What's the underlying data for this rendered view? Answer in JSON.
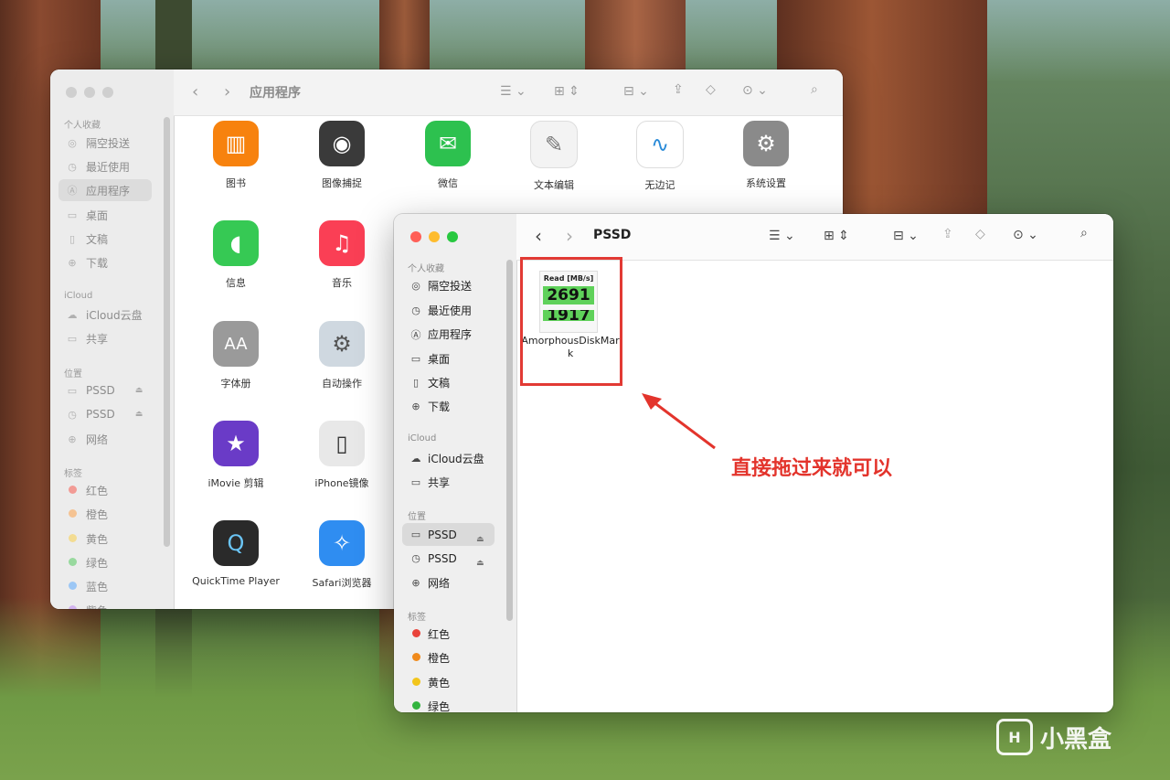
{
  "back_window": {
    "title": "应用程序",
    "sidebar": {
      "favorites_label": "个人收藏",
      "favorites": [
        "隔空投送",
        "最近使用",
        "应用程序",
        "桌面",
        "文稿",
        "下载"
      ],
      "icloud_label": "iCloud",
      "icloud": [
        "iCloud云盘",
        "共享"
      ],
      "locations_label": "位置",
      "locations": [
        "PSSD",
        "PSSD",
        "网络"
      ],
      "tags_label": "标签",
      "tags": [
        {
          "label": "红色",
          "color": "#ff5f57"
        },
        {
          "label": "橙色",
          "color": "#fda648"
        },
        {
          "label": "黄色",
          "color": "#f6d04d"
        },
        {
          "label": "绿色",
          "color": "#5ac463"
        },
        {
          "label": "蓝色",
          "color": "#4b9ef5"
        },
        {
          "label": "紫色",
          "color": "#b67be8"
        }
      ]
    },
    "apps": [
      {
        "label": "图书",
        "icon": "book-icon",
        "color": "#f7820e"
      },
      {
        "label": "图像捕捉",
        "icon": "camera-icon",
        "color": "#3a3a3a"
      },
      {
        "label": "微信",
        "icon": "wechat-icon",
        "color": "#2dc14f"
      },
      {
        "label": "文本编辑",
        "icon": "textedit-icon",
        "color": "#f3f3f3"
      },
      {
        "label": "无边记",
        "icon": "freeform-icon",
        "color": "#ffffff"
      },
      {
        "label": "系统设置",
        "icon": "gear-icon",
        "color": "#8a8a8a"
      },
      {
        "label": "信息",
        "icon": "messages-icon",
        "color": "#36c954"
      },
      {
        "label": "音乐",
        "icon": "music-icon",
        "color": "#fa3f55"
      },
      {
        "label": "字体册",
        "icon": "fontbook-icon",
        "color": "#9a9a9a"
      },
      {
        "label": "自动操作",
        "icon": "automator-icon",
        "color": "#cfd8e0"
      },
      {
        "label": "iMovie 剪辑",
        "icon": "imovie-icon",
        "color": "#6a3bc7"
      },
      {
        "label": "iPhone镜像",
        "icon": "iphone-icon",
        "color": "#e8e8e8"
      },
      {
        "label": "QuickTime Player",
        "icon": "quicktime-icon",
        "color": "#2a2a2a"
      },
      {
        "label": "Safari浏览器",
        "icon": "safari-icon",
        "color": "#2f8df1"
      }
    ]
  },
  "front_window": {
    "title": "PSSD",
    "sidebar": {
      "favorites_label": "个人收藏",
      "favorites": [
        "隔空投送",
        "最近使用",
        "应用程序",
        "桌面",
        "文稿",
        "下载"
      ],
      "icloud_label": "iCloud",
      "icloud": [
        "iCloud云盘",
        "共享"
      ],
      "locations_label": "位置",
      "locations": [
        "PSSD",
        "PSSD",
        "网络"
      ],
      "tags_label": "标签",
      "tags": [
        {
          "label": "红色",
          "color": "#e9433b"
        },
        {
          "label": "橙色",
          "color": "#f08a1c"
        },
        {
          "label": "黄色",
          "color": "#f2c51b"
        },
        {
          "label": "绿色",
          "color": "#33b43f"
        }
      ]
    },
    "file": {
      "thumb_header": "Read [MB/s]",
      "thumb_value1": "2691",
      "thumb_value2": "1917",
      "name": "AmorphousDiskMark"
    }
  },
  "annotation": {
    "text": "直接拖过来就可以",
    "color": "#e3342c"
  },
  "watermark": {
    "text": "小黑盒"
  }
}
